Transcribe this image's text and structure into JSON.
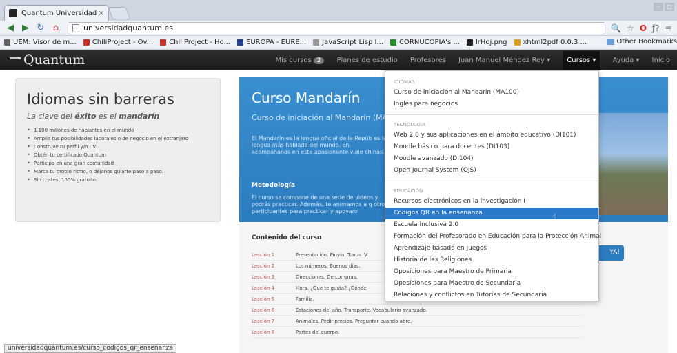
{
  "browser": {
    "tab_title": "Quantum Universidad",
    "tab_close": "×",
    "url": "universidadquantum.es",
    "bookmarks": [
      {
        "label": "UEM: Visor de m...",
        "color": "#666"
      },
      {
        "label": "ChiliProject - Ov...",
        "color": "#c9362b"
      },
      {
        "label": "ChiliProject - Ho...",
        "color": "#c9362b"
      },
      {
        "label": "EUROPA - EURE...",
        "color": "#223f8f"
      },
      {
        "label": "JavaScript Lisp I...",
        "color": "#999"
      },
      {
        "label": "CORNUCOPIA's ...",
        "color": "#2d8f2d"
      },
      {
        "label": "lrHoj.png",
        "color": "#222"
      },
      {
        "label": "xhtml2pdf 0.0.3 ...",
        "color": "#e0a020"
      }
    ],
    "other_bookmarks": "Other Bookmarks",
    "status_url": "universidadquantum.es/curso_codigos_qr_ensenanza"
  },
  "site": {
    "brand": "Quantum",
    "nav": {
      "mis_cursos": "Mis cursos",
      "mis_cursos_count": "2",
      "planes": "Planes de estudio",
      "profesores": "Profesores",
      "user": "Juan Manuel Méndez Rey ▾",
      "cursos": "Cursos ▾",
      "ayuda": "Ayuda ▾",
      "inicio": "Inicio"
    }
  },
  "hero": {
    "title": "Idiomas sin barreras",
    "tagline_pre": "La clave del ",
    "tagline_bold": "éxito",
    "tagline_mid": " es el ",
    "tagline_bold2": "mandarín",
    "bullets": [
      "1.100 millones de hablantes en el mundo",
      "Amplía tus posibilidades laborales o de negocio en el extranjero",
      "Construye tu perfil y/o CV",
      "Obtén tu certificado Quantum",
      "Participa en una gran comunidad",
      "Marca tu propio ritmo, o déjanos guiarte paso a paso.",
      "Sin costes, 100% gratuito."
    ]
  },
  "course": {
    "title": "Curso Mandarín",
    "subtitle": "Curso de iniciación al Mandarín (MA",
    "desc": "El Mandarín es la lengua oficial de la Repúb es la lengua más hablada del mundo. En acompáñanos en este apasionante viaje chinas.",
    "metodologia_title": "Metodología",
    "metodologia_text": "El curso se compone de una serie de videos y podrás practicar. Además, te animamos a q otros participantes para practicar y apoyaro",
    "contenido_title": "Contenido del curso",
    "cta": "YA!",
    "lessons": [
      {
        "n": "Lección 1",
        "t": "Presentación. Pinyin. Tonos. V"
      },
      {
        "n": "Lección 2",
        "t": "Los números. Buenos días."
      },
      {
        "n": "Lección 3",
        "t": "Direcciones. De compras."
      },
      {
        "n": "Lección 4",
        "t": "Hora. ¿Que te gusta? ¿Dónde"
      },
      {
        "n": "Lección 5",
        "t": "Familia."
      },
      {
        "n": "Lección 6",
        "t": "Estaciones del año. Transporte. Vocabulario avanzado."
      },
      {
        "n": "Lección 7",
        "t": "Animales. Pedir precios. Preguntar cuando abre."
      },
      {
        "n": "Lección 8",
        "t": "Partes del cuerpo."
      }
    ]
  },
  "dropdown": {
    "sections": [
      {
        "header": "IDIOMAS",
        "items": [
          "Curso de iniciación al Mandarín (MA100)",
          "Inglés para negocios"
        ]
      },
      {
        "header": "TECNOLOGÍA",
        "items": [
          "Web 2.0 y sus aplicaciones en el ámbito educativo (DI101)",
          "Moodle básico para docentes (DI103)",
          "Moodle avanzado (DI104)",
          "Open Journal System (OJS)"
        ]
      },
      {
        "header": "EDUCACIÓN",
        "items": [
          "Recursos electrónicos en la investigación I",
          "Códigos QR en la enseñanza",
          "Escuela Inclusiva 2.0",
          "Formación del Profesorado en Educación para la Protección Animal",
          "Aprendizaje basado en juegos",
          "Historia de las Religiones",
          "Oposiciones para Maestro de Primaria",
          "Oposiciones para Maestro de Secundaria",
          "Relaciones y conflictos en Tutorías de Secundaria"
        ]
      }
    ],
    "highlighted": "Códigos QR en la enseñanza"
  }
}
